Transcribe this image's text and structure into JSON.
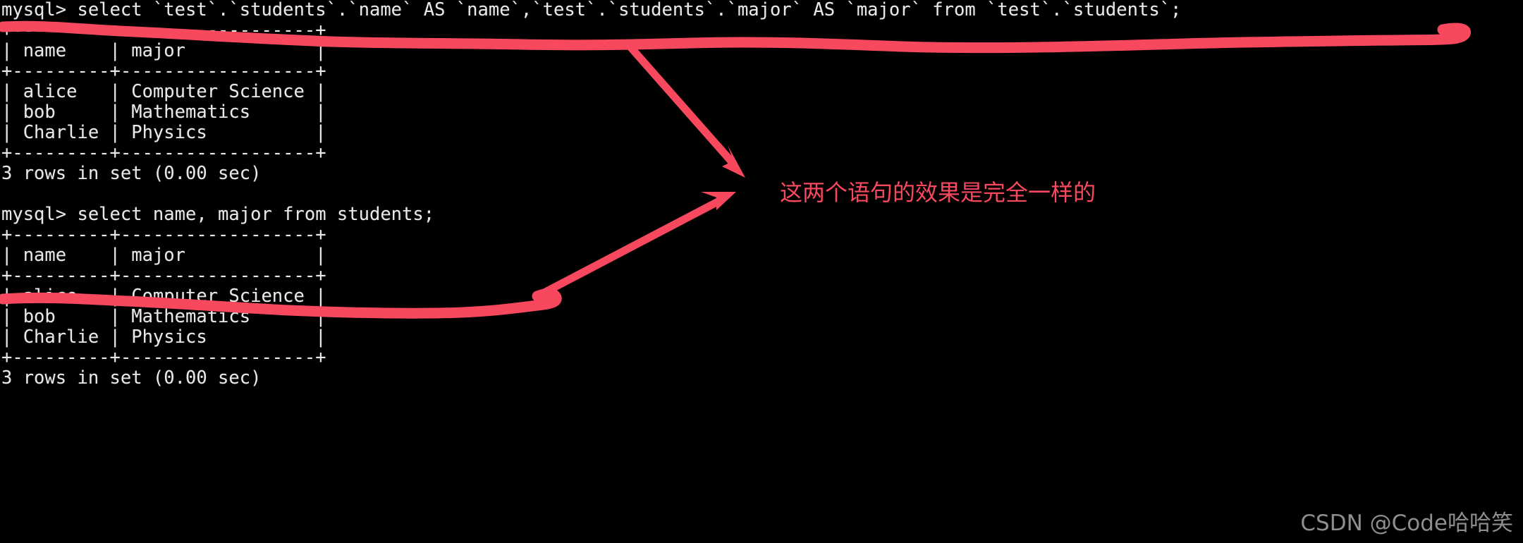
{
  "app": {
    "kind": "mysql-terminal",
    "background_color": "#000000",
    "text_color": "#e8e8e8",
    "annotation_color": "#f8485e",
    "watermark_color": "#8e8e8e"
  },
  "terminal": {
    "lines": [
      "mysql> select `test`.`students`.`name` AS `name`,`test`.`students`.`major` AS `major` from `test`.`students`;",
      "+---------+------------------+",
      "| name    | major            |",
      "+---------+------------------+",
      "| alice   | Computer Science |",
      "| bob     | Mathematics      |",
      "| Charlie | Physics          |",
      "+---------+------------------+",
      "3 rows in set (0.00 sec)",
      "",
      "mysql> select name, major from students;",
      "+---------+------------------+",
      "| name    | major            |",
      "+---------+------------------+",
      "| alice   | Computer Science |",
      "| bob     | Mathematics      |",
      "| Charlie | Physics          |",
      "+---------+------------------+",
      "3 rows in set (0.00 sec)"
    ],
    "prompt": "mysql>",
    "query_one": "select `test`.`students`.`name` AS `name`,`test`.`students`.`major` AS `major` from `test`.`students`;",
    "query_two": "select name, major from students;",
    "result_status": "3 rows in set (0.00 sec)",
    "result_table": {
      "columns": [
        "name",
        "major"
      ],
      "rows": [
        [
          "alice",
          "Computer Science"
        ],
        [
          "bob",
          "Mathematics"
        ],
        [
          "Charlie",
          "Physics"
        ]
      ],
      "row_count": 3,
      "elapsed": "0.00 sec"
    }
  },
  "annotations": {
    "note": "这两个语句的效果是完全一样的",
    "underline_one_label": "underline under first query",
    "underline_two_label": "underline under second query",
    "arrow_one_label": "arrow from first query to note",
    "arrow_two_label": "arrow from second query to note"
  },
  "watermark": {
    "text": "CSDN @Code哈哈笑"
  }
}
